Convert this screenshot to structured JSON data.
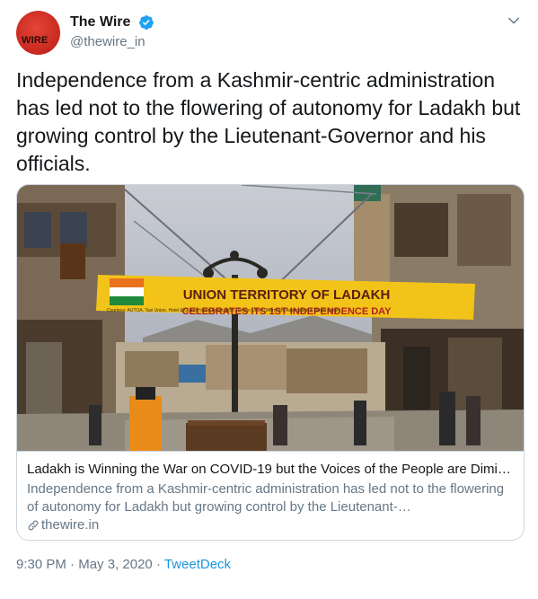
{
  "author": {
    "display_name": "The Wire",
    "handle": "@thewire_in",
    "avatar_text": "WIRE",
    "verified": true
  },
  "tweet": {
    "text": "Independence from a Kashmir-centric administration has led not to the flowering of autonomy for Ladakh but growing control by the Lieutenant-Governor and his officials."
  },
  "card": {
    "title": "Ladakh is Winning the War on COVID-19 but the Voices of the People are Dimi…",
    "description": "Independence from a Kashmir-centric administration has led not to the flowering of autonomy for Ladakh but growing control by the Lieutenant-…",
    "domain": "thewire.in",
    "banner": {
      "line1": "UNION TERRITORY OF LADAKH",
      "line2": "CELEBRATES ITS 1ST INDEPENDENCE DAY",
      "courtesy": "Courtesy: AUTOA, Taxi Union, Hotel & Guest House Association, Tempo Union, Merchant Association & Bikers Union"
    }
  },
  "meta": {
    "time": "9:30 PM",
    "separator": " · ",
    "date": "May 3, 2020",
    "source": "TweetDeck"
  },
  "colors": {
    "accent": "#1b95e0",
    "verified": "#1da1f2",
    "secondary_text": "#657786",
    "brand_red": "#c8281f"
  },
  "icons": [
    "verified-badge-icon",
    "chevron-down-icon",
    "link-icon"
  ]
}
